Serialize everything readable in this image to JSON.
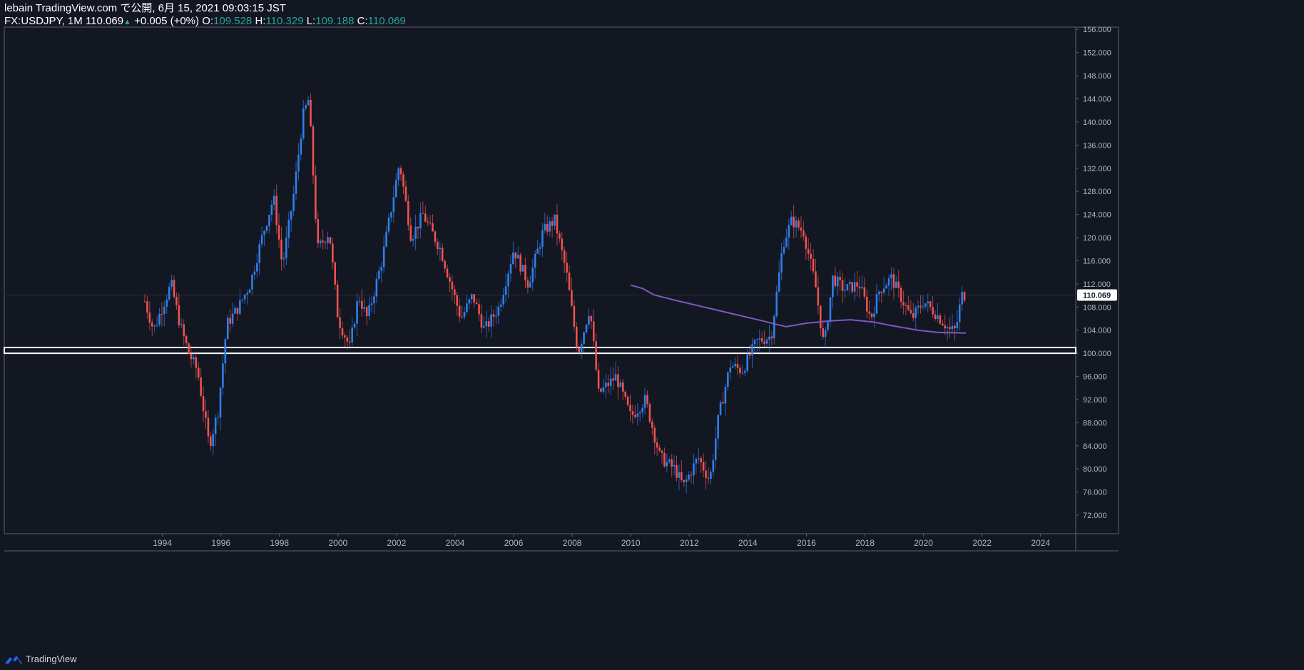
{
  "header": {
    "line1": "lebain TradingView.com で公開, 6月 15, 2021 09:03:15 JST",
    "symbol": "FX:USDJPY, 1M",
    "last": "110.069",
    "up_arrow": "▲",
    "change": "+0.005 (+0%)",
    "o_label": "O:",
    "o_val": "109.528",
    "h_label": "H:",
    "h_val": "110.329",
    "l_label": "L:",
    "l_val": "109.188",
    "c_label": "C:",
    "c_val": "110.069"
  },
  "footer": {
    "brand": "TradingView",
    "logo_icon": "tradingview-logo-icon"
  },
  "colors": {
    "background": "#131722",
    "up": "#2f80ed",
    "down": "#ef5350",
    "ma": "#7e57c2",
    "axis_text": "#b2b5be",
    "border": "#5d606b",
    "price_tag_bg": "#ffffff",
    "price_tag_text": "#131722"
  },
  "chart_data": {
    "type": "candlestick",
    "interval": "1M",
    "x_ticks": [
      "1994",
      "1996",
      "1998",
      "2000",
      "2002",
      "2004",
      "2006",
      "2008",
      "2010",
      "2012",
      "2014",
      "2016",
      "2018",
      "2020",
      "2022",
      "2024"
    ],
    "x_range": [
      1988.6,
      2025.2
    ],
    "y_ticks": [
      "156.000",
      "152.000",
      "148.000",
      "144.000",
      "140.000",
      "136.000",
      "132.000",
      "128.000",
      "124.000",
      "120.000",
      "116.000",
      "112.000",
      "108.000",
      "104.000",
      "100.000",
      "96.000",
      "92.000",
      "88.000",
      "84.000",
      "80.000",
      "76.000",
      "72.000"
    ],
    "y_range": [
      68.8,
      156.4
    ],
    "last_price": "110.069",
    "horizontal_zone": [
      100.0,
      101.0
    ],
    "anchors": [
      [
        1993.4,
        109
      ],
      [
        1993.7,
        104
      ],
      [
        1994.0,
        108
      ],
      [
        1994.3,
        112
      ],
      [
        1994.6,
        105
      ],
      [
        1994.9,
        100
      ],
      [
        1995.2,
        97
      ],
      [
        1995.6,
        84
      ],
      [
        1995.9,
        90
      ],
      [
        1996.2,
        105
      ],
      [
        1996.6,
        108
      ],
      [
        1997.0,
        112
      ],
      [
        1997.4,
        120
      ],
      [
        1997.8,
        127
      ],
      [
        1998.1,
        115
      ],
      [
        1998.5,
        128
      ],
      [
        1998.8,
        141
      ],
      [
        1999.0,
        144
      ],
      [
        1999.3,
        118
      ],
      [
        1999.7,
        121
      ],
      [
        2000.0,
        106
      ],
      [
        2000.4,
        101
      ],
      [
        2000.7,
        110
      ],
      [
        2001.0,
        106
      ],
      [
        2001.5,
        116
      ],
      [
        2002.1,
        133
      ],
      [
        2002.5,
        120
      ],
      [
        2002.9,
        124
      ],
      [
        2003.5,
        118
      ],
      [
        2004.2,
        106
      ],
      [
        2004.6,
        110
      ],
      [
        2005.0,
        104
      ],
      [
        2005.5,
        108
      ],
      [
        2006.0,
        118
      ],
      [
        2006.5,
        112
      ],
      [
        2007.0,
        121
      ],
      [
        2007.4,
        123
      ],
      [
        2007.8,
        114
      ],
      [
        2008.2,
        100
      ],
      [
        2008.6,
        108
      ],
      [
        2008.9,
        93
      ],
      [
        2009.5,
        96
      ],
      [
        2010.0,
        89
      ],
      [
        2010.5,
        92
      ],
      [
        2011.0,
        82
      ],
      [
        2011.5,
        80
      ],
      [
        2011.8,
        77
      ],
      [
        2012.3,
        82
      ],
      [
        2012.7,
        78
      ],
      [
        2013.0,
        89
      ],
      [
        2013.4,
        98
      ],
      [
        2013.8,
        97
      ],
      [
        2014.3,
        102
      ],
      [
        2014.8,
        103
      ],
      [
        2015.2,
        119
      ],
      [
        2015.5,
        123
      ],
      [
        2015.9,
        121
      ],
      [
        2016.3,
        112
      ],
      [
        2016.6,
        101
      ],
      [
        2016.9,
        113
      ],
      [
        2017.3,
        111
      ],
      [
        2017.8,
        112
      ],
      [
        2018.2,
        106
      ],
      [
        2018.5,
        111
      ],
      [
        2018.9,
        113
      ],
      [
        2019.3,
        109
      ],
      [
        2019.6,
        106
      ],
      [
        2020.0,
        109
      ],
      [
        2020.4,
        107
      ],
      [
        2020.9,
        104
      ],
      [
        2021.1,
        104
      ],
      [
        2021.3,
        110
      ],
      [
        2021.45,
        110.07
      ]
    ],
    "moving_average": {
      "color": "#7e57c2",
      "points": [
        [
          2010.0,
          111.8
        ],
        [
          2010.4,
          111.2
        ],
        [
          2010.8,
          110.1
        ],
        [
          2011.5,
          109.2
        ],
        [
          2012.5,
          108.0
        ],
        [
          2013.5,
          106.8
        ],
        [
          2014.5,
          105.6
        ],
        [
          2015.3,
          104.6
        ],
        [
          2016.0,
          105.2
        ],
        [
          2016.8,
          105.6
        ],
        [
          2017.5,
          105.8
        ],
        [
          2018.3,
          105.4
        ],
        [
          2019.0,
          104.7
        ],
        [
          2019.8,
          104.0
        ],
        [
          2020.5,
          103.6
        ],
        [
          2021.45,
          103.5
        ]
      ]
    }
  }
}
